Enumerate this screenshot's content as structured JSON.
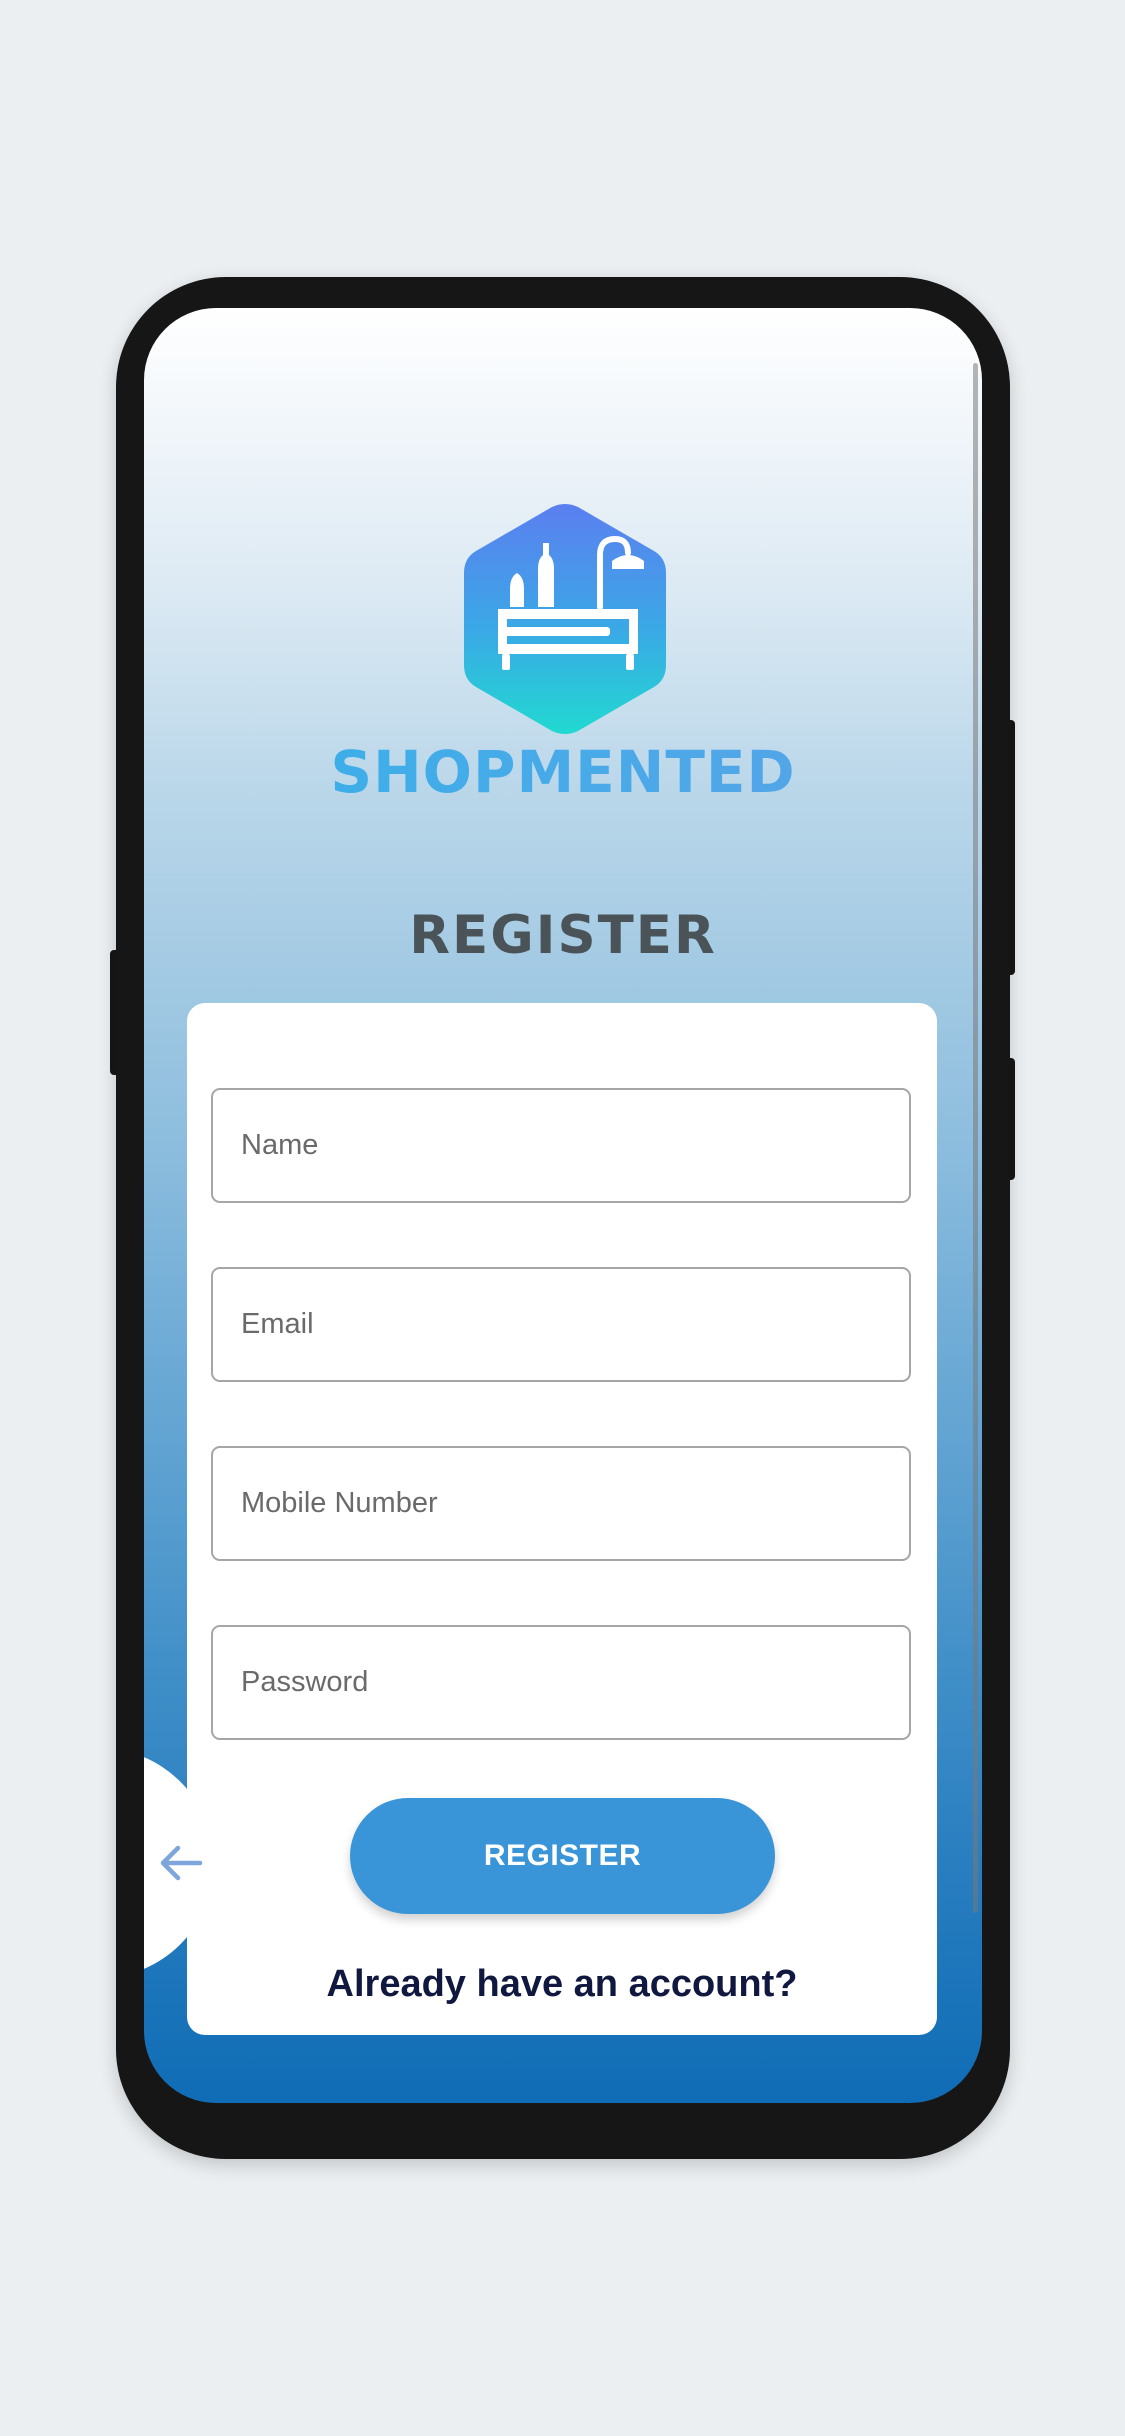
{
  "app": {
    "brand_name": "SHOPMENTED",
    "logo_icon": "furniture-hexagon-logo",
    "colors": {
      "primary": "#3a95d8",
      "brand_gradient_start": "#36b2e8",
      "heading": "#4a5358",
      "link": "#101840"
    }
  },
  "register": {
    "heading": "REGISTER",
    "fields": {
      "name_placeholder": "Name",
      "email_placeholder": "Email",
      "mobile_placeholder": "Mobile Number",
      "password_placeholder": "Password"
    },
    "submit_label": "REGISTER",
    "login_link": "Already have an account?"
  },
  "back_button": {
    "icon": "arrow-left-icon"
  }
}
